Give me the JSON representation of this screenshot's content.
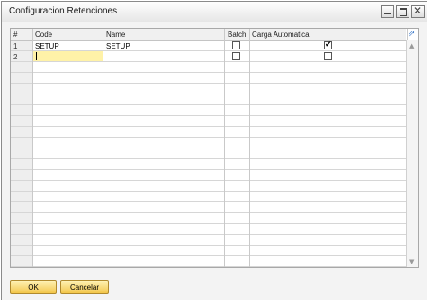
{
  "window": {
    "title": "Configuracion Retenciones",
    "controls": [
      "minimize-icon",
      "maximize-icon",
      "close-icon"
    ]
  },
  "grid": {
    "columns": {
      "rownum": "#",
      "code": "Code",
      "name": "Name",
      "batch": "Batch",
      "carga": "Carga Automatica"
    },
    "rows": [
      {
        "num": "1",
        "code": "SETUP",
        "name": "SETUP",
        "batch": false,
        "carga": true
      },
      {
        "num": "2",
        "code": "",
        "name": "",
        "batch": false,
        "carga": false
      }
    ],
    "corner_icon": "expand-arrow-icon"
  },
  "buttons": {
    "ok": "OK",
    "cancel": "Cancelar"
  },
  "colors": {
    "button_gold": "#f3c64a",
    "active_cell": "#fff2a8",
    "link_blue": "#3a78c8"
  }
}
